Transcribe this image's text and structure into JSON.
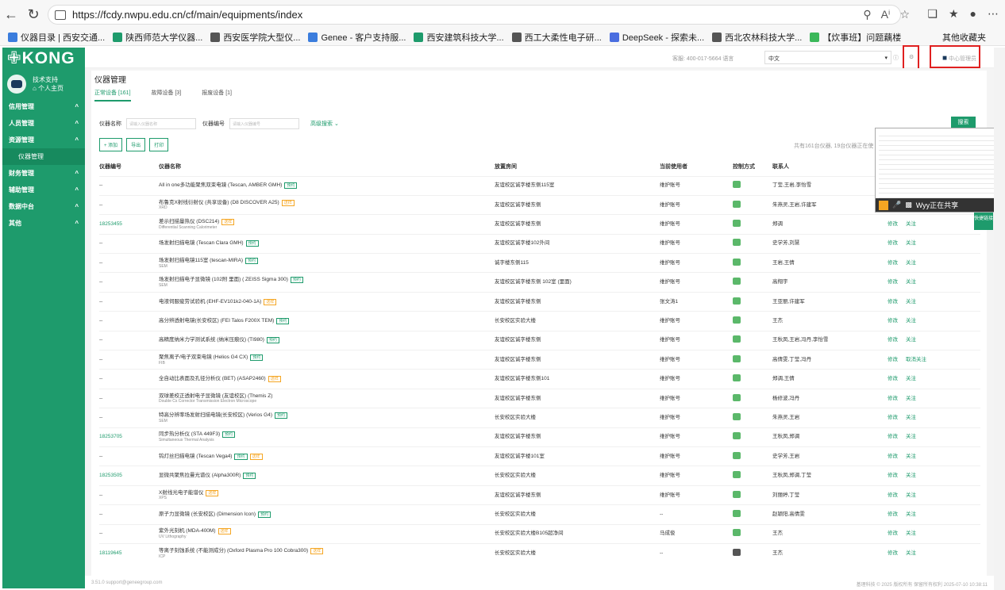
{
  "browser": {
    "url": "https://fcdy.nwpu.edu.cn/cf/main/equipments/index"
  },
  "bookmarks": [
    "仪器目录 | 西安交通...",
    "陕西师范大学仪器...",
    "西安医学院大型仪...",
    "Genee - 客户支持服...",
    "西安建筑科技大学...",
    "西工大柔性电子研...",
    "DeepSeek - 探索未...",
    "西北农林科技大学...",
    "【炊事班】问题藕楼"
  ],
  "bookmark_other": "其他收藏夹",
  "sidebar": {
    "logo": "KONG",
    "user_name": "技术支持",
    "user_home": "个人主页",
    "menu": [
      "信用管理",
      "人员管理",
      "资源管理",
      "仪器管理",
      "财务管理",
      "辅助管理",
      "数据中台",
      "其他"
    ]
  },
  "topbar": {
    "hotline": "客服: 400-017-5664 语言",
    "lang": "中文",
    "center": "中心管理员"
  },
  "page": {
    "title": "仪器管理",
    "tabs": [
      "正常设备 [161]",
      "故障设备 [3]",
      "报废设备 [1]"
    ],
    "filter_name": "仪器名称",
    "filter_name_ph": "请输入仪器名称",
    "filter_code": "仪器编号",
    "filter_code_ph": "请输入仪器编号",
    "advanced": "高级搜索",
    "search": "搜索",
    "actions": [
      "+ 添加",
      "导出",
      "打印"
    ],
    "total": "共有161台仪器, 19台仪器正在使",
    "headers": [
      "仪器编号",
      "仪器名称",
      "放置房间",
      "当前使用者",
      "控制方式",
      "联系人"
    ]
  },
  "rows": [
    {
      "id": "--",
      "name": "All in one多功能聚焦双束电镜 (Tescan, AMBER GMH)",
      "en": "",
      "tag": "预约",
      "tagc": "g",
      "room": "友谊校区诚字楼东侧115室",
      "user": "维护账号",
      "contact": "丁莹,王岩,李怡雪",
      "ops": []
    },
    {
      "id": "--",
      "name": "布鲁克X射线衍射仪 (共享设备) (D8 DISCOVER A25)",
      "en": "XRD",
      "tag": "送样",
      "tagc": "o",
      "room": "友谊校区诚字楼东侧",
      "user": "维护账号",
      "contact": "朱燕灵,王岩,许建军",
      "ops": []
    },
    {
      "id": "18253455",
      "name": "差示扫描量热仪 (DSC214)",
      "en": "Differential Scanning Calorimeter",
      "tag": "送样",
      "tagc": "o",
      "room": "友谊校区诚字楼东侧",
      "user": "维护账号",
      "contact": "郑调",
      "ops": [
        "修改",
        "关注"
      ]
    },
    {
      "id": "--",
      "name": "场发射扫描电镜 (Tescan Clara GMH)",
      "en": "",
      "tag": "预约",
      "tagc": "g",
      "room": "友谊校区诚字楼102外间",
      "user": "维护账号",
      "contact": "史学芳,刘慧",
      "ops": [
        "修改",
        "关注"
      ]
    },
    {
      "id": "--",
      "name": "场发射扫描电镜115室 (tescan-MIRA)",
      "en": "SEM",
      "tag": "预约",
      "tagc": "g",
      "room": "诚字楼东侧115",
      "user": "维护账号",
      "contact": "王岩,王倩",
      "ops": [
        "修改",
        "关注"
      ]
    },
    {
      "id": "--",
      "name": "场发射扫描电子显微镜 (102附 里面) ( ZEISS Sigma 300)",
      "en": "SEM",
      "tag": "预约",
      "tagc": "g",
      "room": "友谊校区诚字楼东侧 102室 (里面)",
      "user": "维护账号",
      "contact": "高翔宇",
      "ops": [
        "修改",
        "关注"
      ]
    },
    {
      "id": "--",
      "name": "电液伺服疲劳试验机 (EHF-EV101k2-040-1A)",
      "en": "",
      "tag": "送样",
      "tagc": "o",
      "room": "友谊校区诚字楼东侧",
      "user": "张文涛1",
      "contact": "王亚丽,许建军",
      "ops": [
        "修改",
        "关注"
      ]
    },
    {
      "id": "--",
      "name": "高分辨透射电镜(长安校区) (FEI Talos F200X TEM)",
      "en": "",
      "tag": "预约",
      "tagc": "g",
      "room": "长安校区实验大楼",
      "user": "维护账号",
      "contact": "王杰",
      "ops": [
        "修改",
        "关注"
      ]
    },
    {
      "id": "--",
      "name": "高精度纳米力学测试系统 (纳米压痕仪) (TI980)",
      "en": "",
      "tag": "预约",
      "tagc": "g",
      "room": "友谊校区诚字楼东侧",
      "user": "维护账号",
      "contact": "王秋凤,王岩,冯丹,李怡雪",
      "ops": [
        "修改",
        "关注"
      ]
    },
    {
      "id": "--",
      "name": "聚焦离子/电子双束电镜 (Helios G4 CX)",
      "en": "FIB",
      "tag": "预约",
      "tagc": "g",
      "room": "友谊校区诚字楼东侧",
      "user": "维护账号",
      "contact": "高倩雯,丁莹,冯丹",
      "ops": [
        "修改",
        "取消关注"
      ]
    },
    {
      "id": "--",
      "name": "全自动比表面及孔径分析仪 (BET) (ASAP2460)",
      "en": "",
      "tag": "送样",
      "tagc": "o",
      "room": "友谊校区诚字楼东侧101",
      "user": "维护账号",
      "contact": "郑调,王倩",
      "ops": [
        "修改",
        "关注"
      ]
    },
    {
      "id": "--",
      "name": "双球差校正透射电子显微镜 (友谊校区) (Themis Z)",
      "en": "Double Cs Corrector Transmission Electron Microscope",
      "tag": "",
      "tagc": "",
      "room": "友谊校区诚字楼东侧",
      "user": "维护账号",
      "contact": "杨修波,冯丹",
      "ops": [
        "修改",
        "关注"
      ]
    },
    {
      "id": "--",
      "name": "特高分辨率场发射扫描电镜(长安校区) (Verios G4)",
      "en": "SEM",
      "tag": "预约",
      "tagc": "g",
      "room": "长安校区实验大楼",
      "user": "维护账号",
      "contact": "朱燕灵,王岩",
      "ops": [
        "修改",
        "关注"
      ]
    },
    {
      "id": "18253705",
      "name": "同步热分析仪 (STA 449F3)",
      "en": "Simultaneous Thermal Analysis",
      "tag": "预约",
      "tagc": "g",
      "room": "友谊校区诚字楼东侧",
      "user": "维护账号",
      "contact": "王秋凤,郑调",
      "ops": [
        "修改",
        "关注"
      ]
    },
    {
      "id": "--",
      "name": "钨灯丝扫描电镜 (Tescan Vega4)",
      "en": "",
      "tag": "预约",
      "tagc": "g",
      "tag2": "送样",
      "room": "友谊校区诚字楼101室",
      "user": "维护账号",
      "contact": "史学芳,王岩",
      "ops": [
        "修改",
        "关注"
      ]
    },
    {
      "id": "18253505",
      "name": "显微共聚焦拉曼光谱仪 (Alpha300R)",
      "en": "",
      "tag": "预约",
      "tagc": "g",
      "room": "长安校区实验大楼",
      "user": "维护账号",
      "contact": "王秋凤,郑调,丁莹",
      "ops": [
        "修改",
        "关注"
      ]
    },
    {
      "id": "--",
      "name": "X射线光电子能谱仪",
      "en": "XPS",
      "tag": "送样",
      "tagc": "o",
      "room": "友谊校区诚字楼东侧",
      "user": "维护账号",
      "contact": "刘丽婷,丁莹",
      "ops": [
        "修改",
        "关注"
      ]
    },
    {
      "id": "--",
      "name": "原子力显微镜 (长安校区) (Dimension Icon)",
      "en": "",
      "tag": "预约",
      "tagc": "g",
      "room": "长安校区实验大楼",
      "user": "--",
      "contact": "赵颖阳,高倩雯",
      "ops": [
        "修改",
        "关注"
      ]
    },
    {
      "id": "--",
      "name": "紫外光刻机 (MDA-400M)",
      "en": "UV Lithography",
      "tag": "送样",
      "tagc": "o",
      "room": "长安校区实验大楼B105超净间",
      "user": "马成俊",
      "contact": "王杰",
      "ops": [
        "修改",
        "关注"
      ]
    },
    {
      "id": "18119645",
      "name": "等离子刻蚀系统 (不能测成分) (Oxford Plasma Pro 100 Cobra300)",
      "en": "ICP",
      "tag": "送样",
      "tagc": "o",
      "room": "长安校区实验大楼",
      "user": "--",
      "contact": "王杰",
      "ops": [
        "修改",
        "关注"
      ]
    }
  ],
  "share": {
    "label": "Wyy正在共享"
  },
  "quick": "快捷链接",
  "footer": {
    "left": "3.51.0    support@geneegroup.com",
    "right": "基理科技 © 2025 版权所有  保留所有权利  2025-07-10 10:38:11"
  }
}
